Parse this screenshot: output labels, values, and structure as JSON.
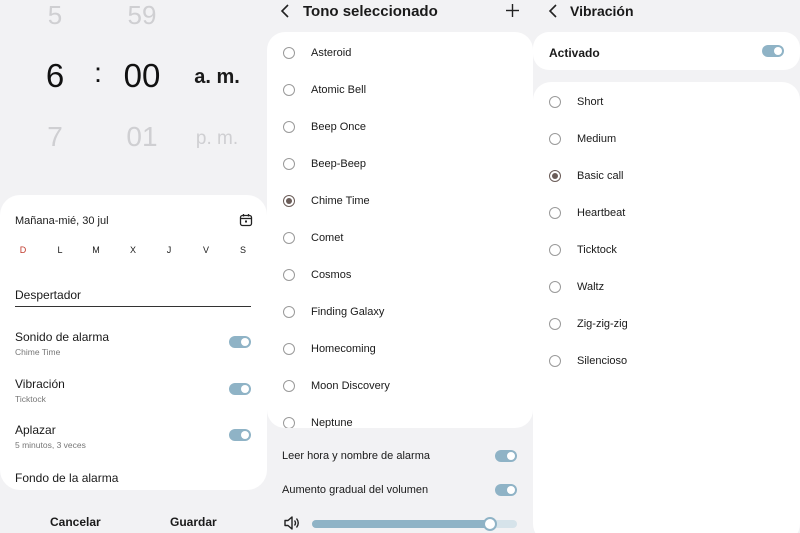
{
  "alarm_editor": {
    "time": {
      "hour_above": "5",
      "minute_above": "59",
      "hour": "6",
      "separator": ":",
      "minute": "00",
      "period": "a. m.",
      "hour_below": "7",
      "minute_below": "01",
      "period_below": "p. m."
    },
    "date_label": "Mañana-mié, 30 jul",
    "days": [
      "D",
      "L",
      "M",
      "X",
      "J",
      "V",
      "S"
    ],
    "name_label": "Despertador",
    "settings": [
      {
        "title": "Sonido de alarma",
        "subtitle": "Chime Time",
        "on": true
      },
      {
        "title": "Vibración",
        "subtitle": "Ticktock",
        "on": true
      },
      {
        "title": "Aplazar",
        "subtitle": "5 minutos, 3 veces",
        "on": true
      }
    ],
    "background_label": "Fondo de la alarma",
    "cancel_label": "Cancelar",
    "save_label": "Guardar"
  },
  "tone_screen": {
    "title": "Tono seleccionado",
    "tones": [
      "Asteroid",
      "Atomic Bell",
      "Beep Once",
      "Beep-Beep",
      "Chime Time",
      "Comet",
      "Cosmos",
      "Finding Galaxy",
      "Homecoming",
      "Moon Discovery",
      "Neptune"
    ],
    "selected": "Chime Time",
    "options": [
      {
        "label": "Leer hora y nombre de alarma",
        "on": true
      },
      {
        "label": "Aumento gradual del volumen",
        "on": true
      }
    ],
    "volume_fraction": 0.87
  },
  "vibration_screen": {
    "title": "Vibración",
    "activated_label": "Activado",
    "activated_on": true,
    "patterns": [
      "Short",
      "Medium",
      "Basic call",
      "Heartbeat",
      "Ticktock",
      "Waltz",
      "Zig-zig-zig",
      "Silencioso"
    ],
    "selected": "Basic call"
  },
  "colors": {
    "accent": "#8fb3c6",
    "sunday": "#c0392b",
    "selected_radio": "#6a5c58"
  }
}
